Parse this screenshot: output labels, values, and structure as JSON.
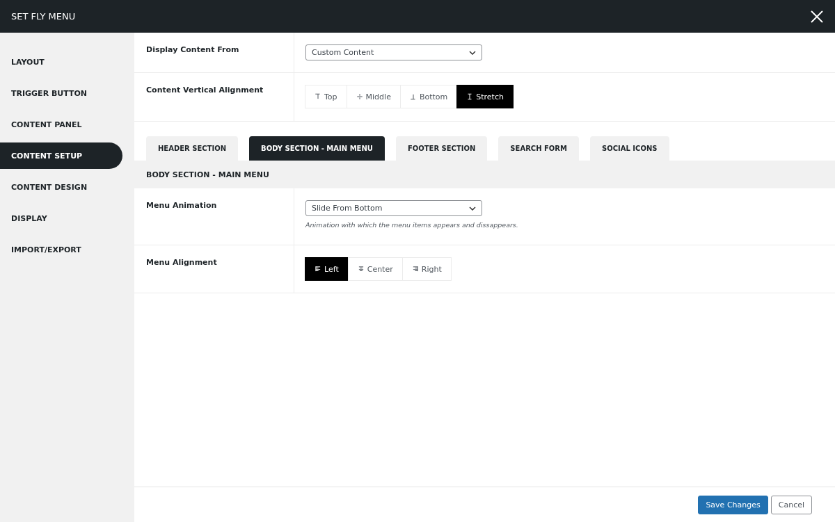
{
  "window": {
    "title": "SET FLY MENU"
  },
  "sidebar": {
    "items": [
      {
        "label": "LAYOUT",
        "selected": false
      },
      {
        "label": "TRIGGER BUTTON",
        "selected": false
      },
      {
        "label": "CONTENT PANEL",
        "selected": false
      },
      {
        "label": "CONTENT SETUP",
        "selected": true
      },
      {
        "label": "CONTENT DESIGN",
        "selected": false
      },
      {
        "label": "DISPLAY",
        "selected": false
      },
      {
        "label": "IMPORT/EXPORT",
        "selected": false
      }
    ]
  },
  "top_settings": [
    {
      "label": "Display Content From",
      "kind": "select",
      "value": "Custom Content"
    },
    {
      "label": "Content Vertical Alignment",
      "kind": "buttons",
      "options": [
        {
          "kind": "top",
          "label": "Top",
          "selected": false
        },
        {
          "kind": "middle",
          "label": "Middle",
          "selected": false
        },
        {
          "kind": "bottom",
          "label": "Bottom",
          "selected": false
        },
        {
          "kind": "stretch",
          "label": "Stretch",
          "selected": true
        }
      ]
    }
  ],
  "tabs": [
    {
      "label": "HEADER SECTION",
      "selected": false
    },
    {
      "label": "BODY SECTION - MAIN MENU",
      "selected": true
    },
    {
      "label": "FOOTER SECTION",
      "selected": false
    },
    {
      "label": "SEARCH FORM",
      "selected": false
    },
    {
      "label": "SOCIAL ICONS",
      "selected": false
    }
  ],
  "section": {
    "title": "BODY SECTION - MAIN MENU",
    "settings": [
      {
        "label": "Menu Animation",
        "kind": "select",
        "value": "Slide From Bottom",
        "help": "Animation with which the menu items appears and dissappears."
      },
      {
        "label": "Menu Alignment",
        "kind": "buttons",
        "options": [
          {
            "kind": "left",
            "label": "Left",
            "selected": true
          },
          {
            "kind": "center",
            "label": "Center",
            "selected": false
          },
          {
            "kind": "right",
            "label": "Right",
            "selected": false
          }
        ]
      }
    ]
  },
  "footer": {
    "buttons": [
      {
        "kind": "primary",
        "label": "Save Changes"
      },
      {
        "kind": "secondary",
        "label": "Cancel"
      }
    ]
  }
}
